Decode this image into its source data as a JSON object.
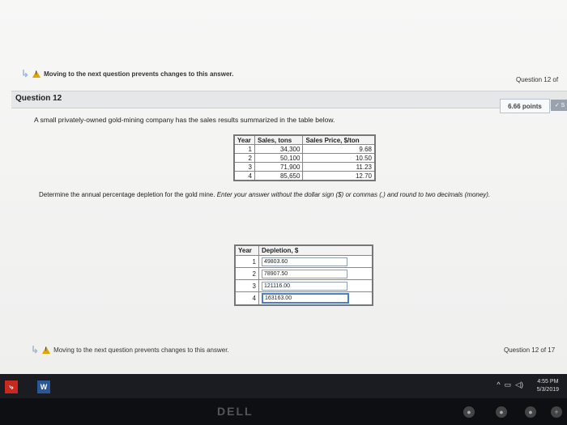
{
  "warning_top": {
    "text": "Moving to the next question prevents changes to this answer."
  },
  "question_counter_top": "Question 12 of",
  "question_header": {
    "title": "Question 12"
  },
  "points": "6.66 points",
  "save_chip": "✓ S",
  "prompt": "A small privately-owned gold-mining company has the sales results summarized in the table below.",
  "sales_table": {
    "headers": [
      "Year",
      "Sales, tons",
      "Sales Price, $/ton"
    ],
    "rows": [
      [
        "1",
        "34,300",
        "9.68"
      ],
      [
        "2",
        "50,100",
        "10.50"
      ],
      [
        "3",
        "71,900",
        "11.23"
      ],
      [
        "4",
        "85,650",
        "12.70"
      ]
    ]
  },
  "instruction": {
    "plain": "Determine the annual percentage depletion for the gold mine. ",
    "italic": "Enter your answer without the dollar sign ($) or commas (,) and round to two decimals (money)."
  },
  "depletion_table": {
    "headers": [
      "Year",
      "Depletion, $"
    ],
    "rows": [
      {
        "year": "1",
        "value": "49803.60"
      },
      {
        "year": "2",
        "value": "78907.50"
      },
      {
        "year": "3",
        "value": "121116.00"
      },
      {
        "year": "4",
        "value": "163163.00"
      }
    ]
  },
  "warning_bottom": {
    "text": "Moving to the next question prevents changes to this answer."
  },
  "question_counter_bottom": "Question 12 of 17",
  "taskbar": {
    "clock_time": "4:55 PM",
    "clock_date": "5/3/2019"
  },
  "bezel_brand": "DELL"
}
